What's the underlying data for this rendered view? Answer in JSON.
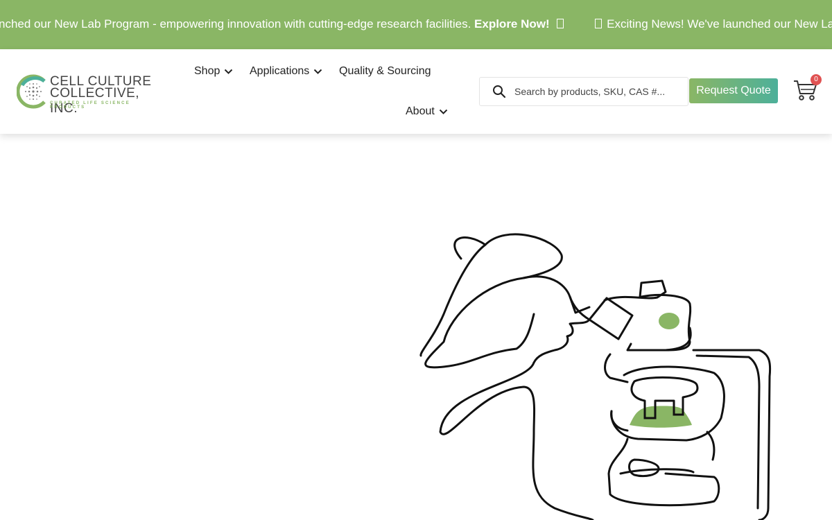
{
  "announcement": {
    "text_a": "nched our New Lab Program - empowering innovation with cutting-edge research facilities.",
    "cta_a": "Explore Now!",
    "text_b": "Exciting News! We've launched our New Lab Program"
  },
  "brand": {
    "line1": "CELL CULTURE",
    "line2": "COLLECTIVE, INC.",
    "tagline": "CURATED LIFE SCIENCE PRODUCTS",
    "colors": {
      "green": "#8ab665",
      "teal": "#4db09a",
      "gray": "#9a9a9a"
    }
  },
  "nav": {
    "shop": "Shop",
    "applications": "Applications",
    "quality": "Quality & Sourcing",
    "about": "About"
  },
  "search": {
    "placeholder": "Search by products, SKU, CAS #..."
  },
  "header": {
    "quote_label": "Request Quote",
    "cart_count": "0"
  },
  "icons": {
    "search": "search-icon",
    "cart": "cart-icon",
    "chevron": "chevron-down-icon"
  },
  "hero": {
    "illustration": "scientist-microscope-line-art",
    "accent": "#8ab665"
  }
}
